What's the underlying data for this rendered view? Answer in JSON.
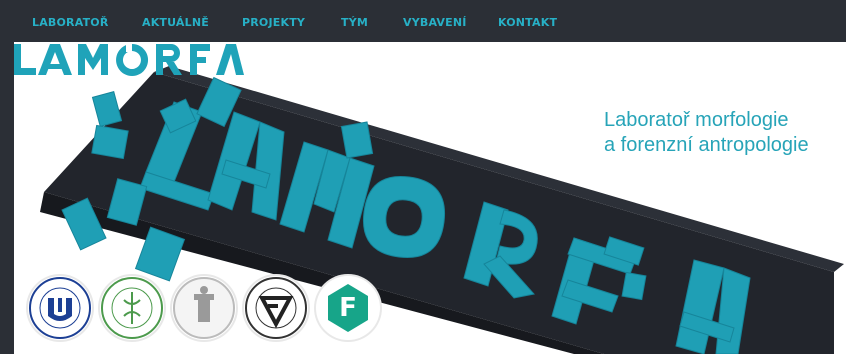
{
  "navbar": {
    "items": [
      {
        "label": "LABORATOŘ"
      },
      {
        "label": "AKTUÁLNĚ"
      },
      {
        "label": "PROJEKTY"
      },
      {
        "label": "TÝM"
      },
      {
        "label": "VYBAVENÍ"
      },
      {
        "label": "KONTAKT"
      }
    ]
  },
  "brand": {
    "logo_text": "LAMORFA",
    "tagline_line1": "Laboratoř morfologie",
    "tagline_line2": "a forenzní antropologie"
  },
  "partner_logos": [
    {
      "name": "university-seal",
      "text": "UNIVERSITAS MASARYKIANA BRUNENSIS"
    },
    {
      "name": "faculty-seal",
      "text": ""
    },
    {
      "name": "museum-seal",
      "text": ""
    },
    {
      "name": "forensic-seal",
      "text": ""
    },
    {
      "name": "f-badge",
      "text": "F"
    }
  ],
  "colors": {
    "nav_bg": "#2b2f36",
    "accent": "#27b0c6",
    "teal_block": "#1e9bb0",
    "dark_slab": "#20232a"
  }
}
